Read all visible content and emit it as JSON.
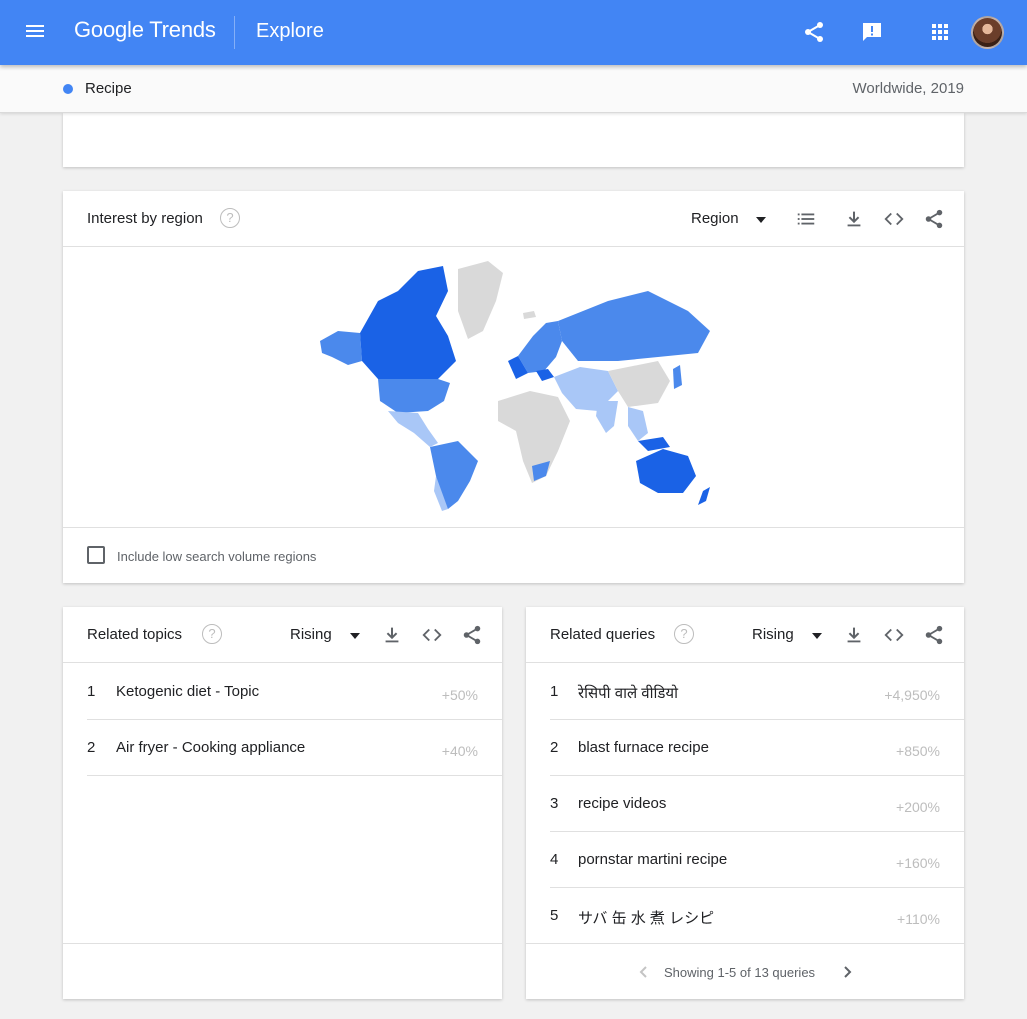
{
  "header": {
    "logo_text": "Google Trends",
    "section": "Explore"
  },
  "subheader": {
    "term": "Recipe",
    "term_color": "#4285f4",
    "scope": "Worldwide, 2019"
  },
  "region": {
    "title": "Interest by region",
    "help": "?",
    "dropdown_value": "Region",
    "checkbox_label": "Include low search volume regions",
    "checkbox_checked": false
  },
  "related_topics": {
    "title": "Related topics",
    "help": "?",
    "dropdown_value": "Rising",
    "rows": [
      {
        "rank": "1",
        "label": "Ketogenic diet - Topic",
        "value": "+50%"
      },
      {
        "rank": "2",
        "label": "Air fryer - Cooking appliance",
        "value": "+40%"
      }
    ]
  },
  "related_queries": {
    "title": "Related queries",
    "help": "?",
    "dropdown_value": "Rising",
    "rows": [
      {
        "rank": "1",
        "label": "रेसिपी वाले वीडियो",
        "value": "+4,950%"
      },
      {
        "rank": "2",
        "label": "blast furnace recipe",
        "value": "+850%"
      },
      {
        "rank": "3",
        "label": "recipe videos",
        "value": "+200%"
      },
      {
        "rank": "4",
        "label": "pornstar martini recipe",
        "value": "+160%"
      },
      {
        "rank": "5",
        "label": "サバ 缶 水 煮 レシピ",
        "value": "+110%"
      }
    ],
    "pager": "Showing 1-5 of 13 queries"
  },
  "colors": {
    "brand": "#4285f4",
    "map_high": "#1a62e6",
    "map_mid": "#4b89ec",
    "map_low": "#a9c7f7",
    "map_none": "#d9d9d9"
  }
}
